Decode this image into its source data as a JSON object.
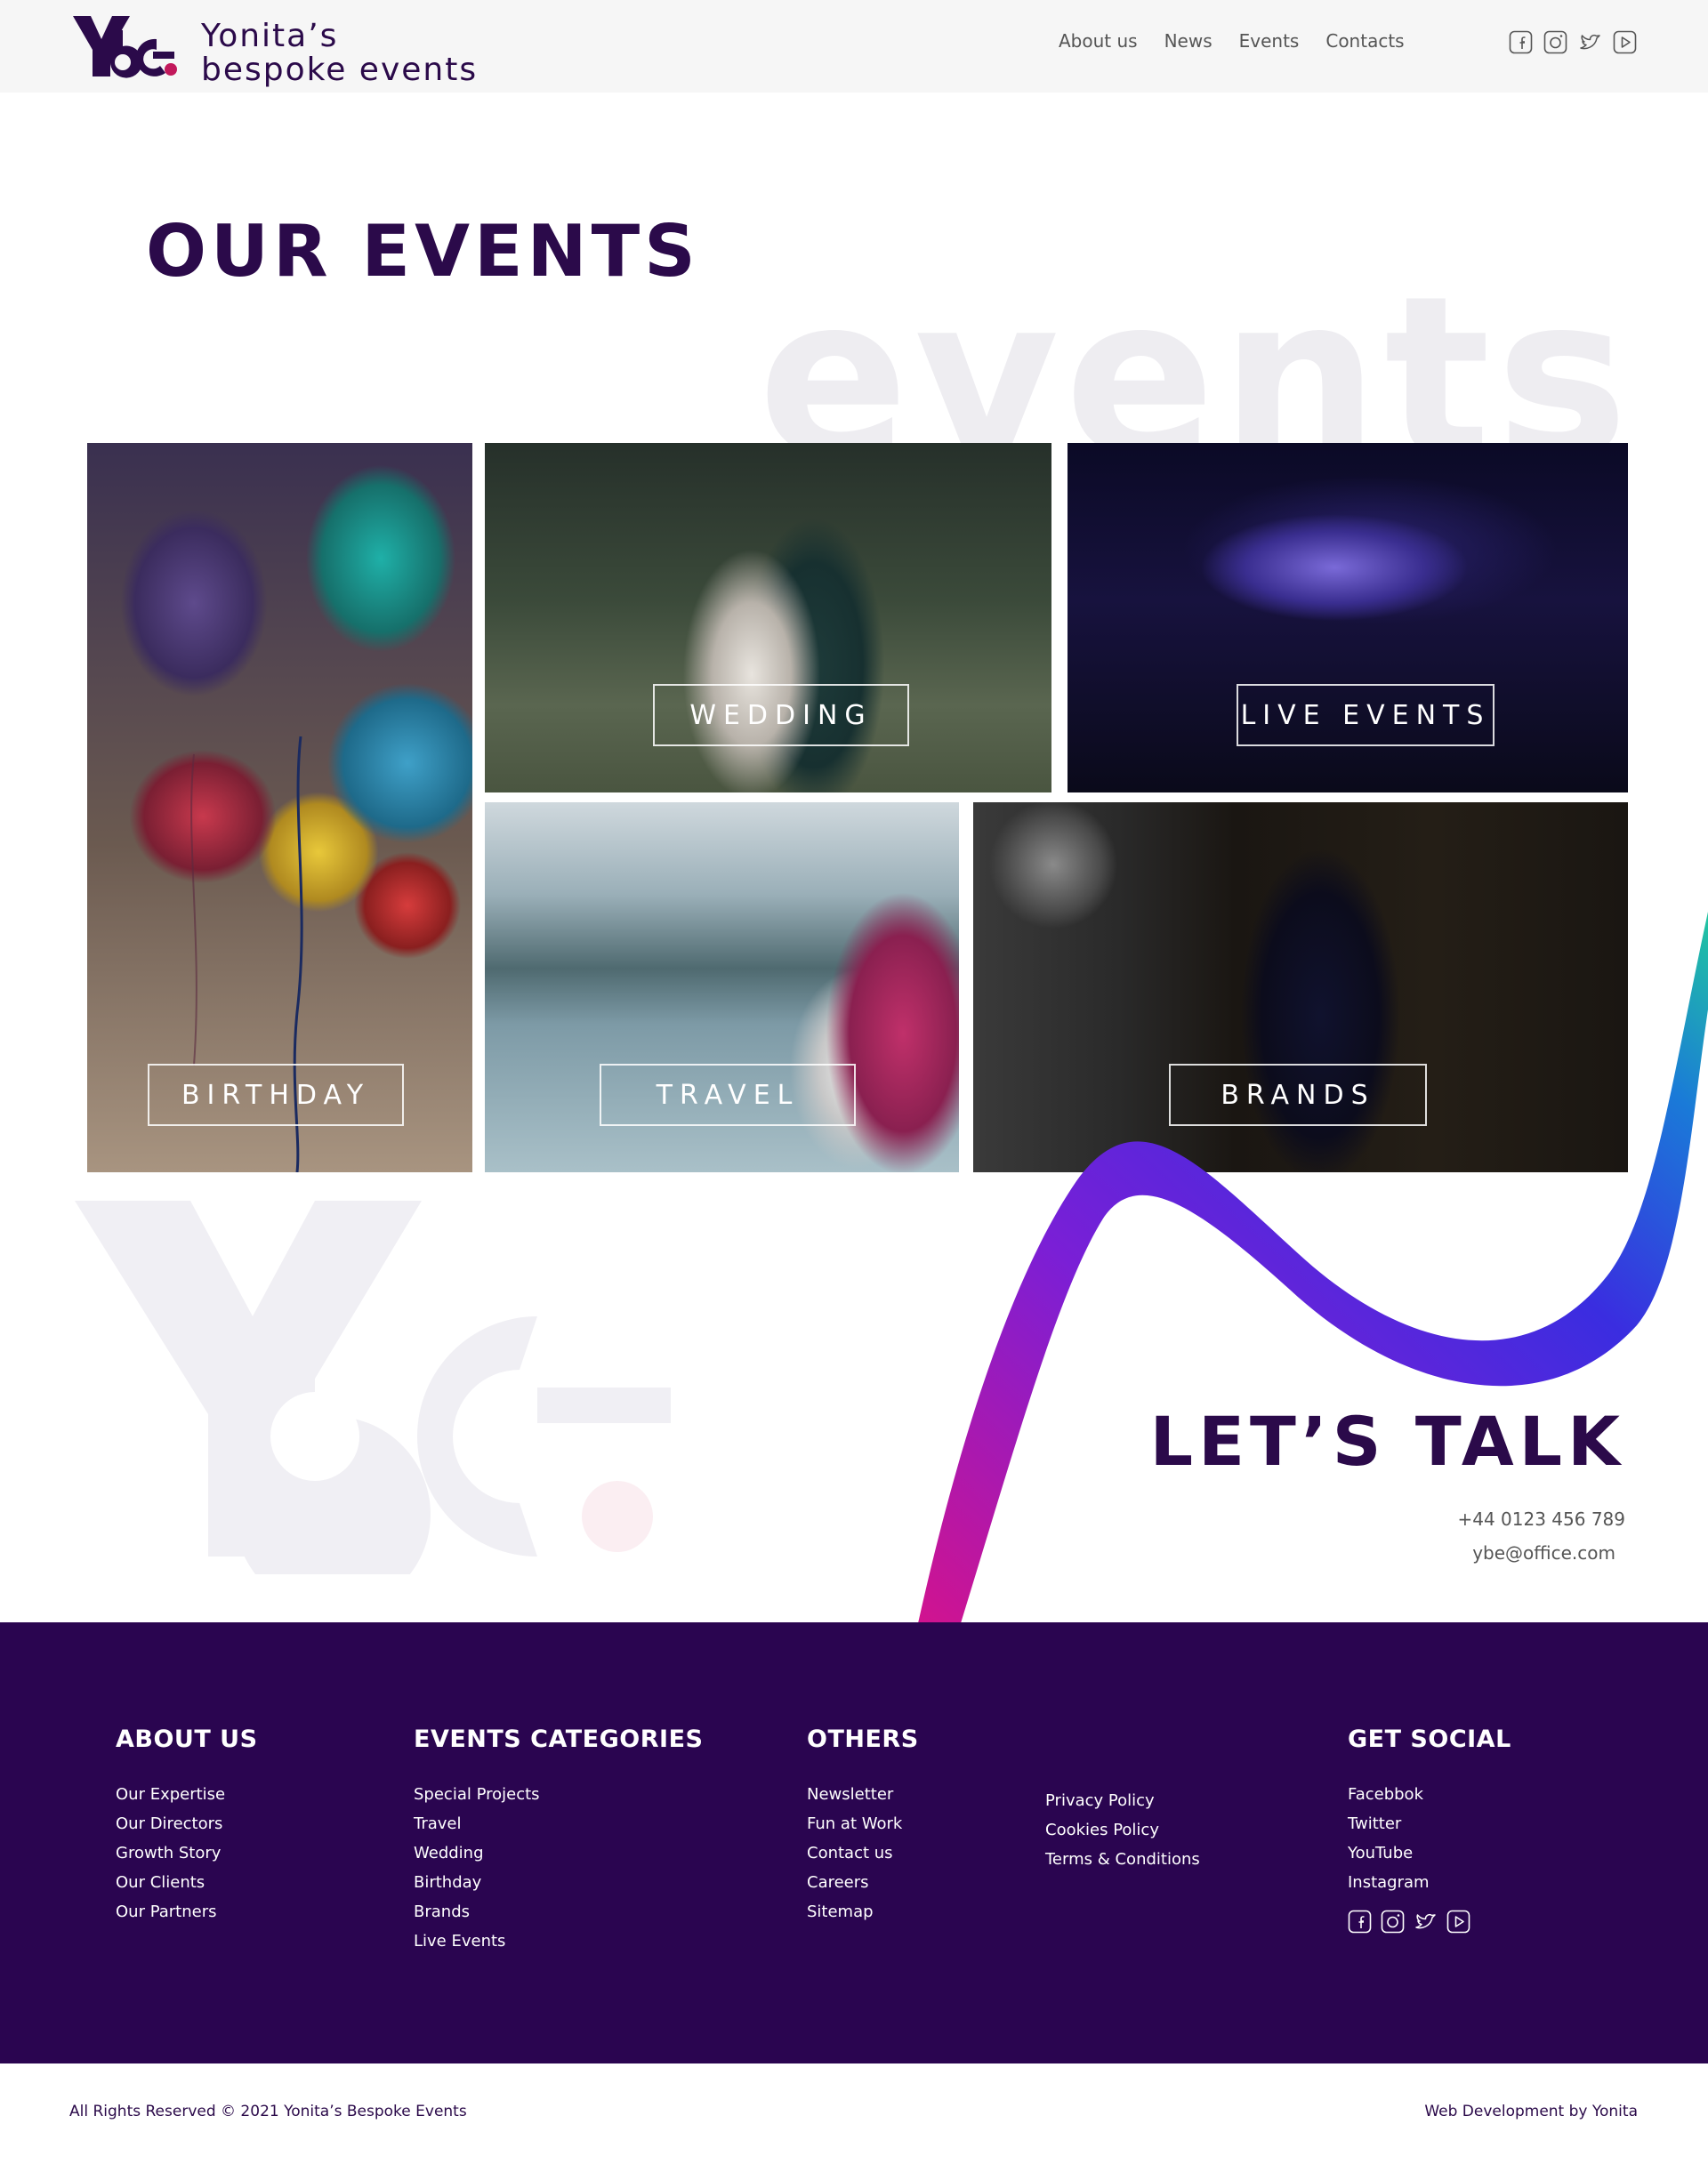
{
  "header": {
    "logo_line1": "Yonita’s",
    "logo_line2": "bespoke events",
    "nav": [
      "About us",
      "News",
      "Events",
      "Contacts"
    ],
    "social_icons": [
      "facebook-icon",
      "instagram-icon",
      "twitter-icon",
      "youtube-icon"
    ]
  },
  "events": {
    "title": "OUR EVENTS",
    "background_word": "events",
    "tiles": [
      {
        "label": "BIRTHDAY"
      },
      {
        "label": "WEDDING"
      },
      {
        "label": "LIVE EVENTS"
      },
      {
        "label": "TRAVEL"
      },
      {
        "label": "BRANDS"
      }
    ]
  },
  "talk": {
    "title": "LET’S TALK",
    "phone": "+44 0123 456 789",
    "email": "ybe@office.com"
  },
  "footer": {
    "about": {
      "heading": "ABOUT US",
      "items": [
        "Our Expertise",
        "Our Directors",
        "Growth Story",
        "Our Clients",
        "Our Partners"
      ]
    },
    "categories": {
      "heading": "EVENTS CATEGORIES",
      "items": [
        "Special Projects",
        "Travel",
        "Wedding",
        "Birthday",
        "Brands",
        "Live Events"
      ]
    },
    "others": {
      "heading": "OTHERS",
      "items": [
        "Newsletter",
        "Fun at Work",
        "Contact us",
        "Careers",
        "Sitemap"
      ],
      "items2": [
        "Privacy Policy",
        "Cookies Policy",
        "Terms & Conditions"
      ]
    },
    "social": {
      "heading": "GET SOCIAL",
      "items": [
        "Facebbok",
        "Twitter",
        "YouTube",
        "Instagram"
      ]
    }
  },
  "bottom": {
    "copyright": "All Rights Reserved © 2021 Yonita’s Bespoke Events",
    "credit": "Web Development by Yonita"
  },
  "colors": {
    "brand_purple": "#2b0a4a",
    "footer_bg": "#2a0550",
    "accent_pink": "#c2185b"
  }
}
